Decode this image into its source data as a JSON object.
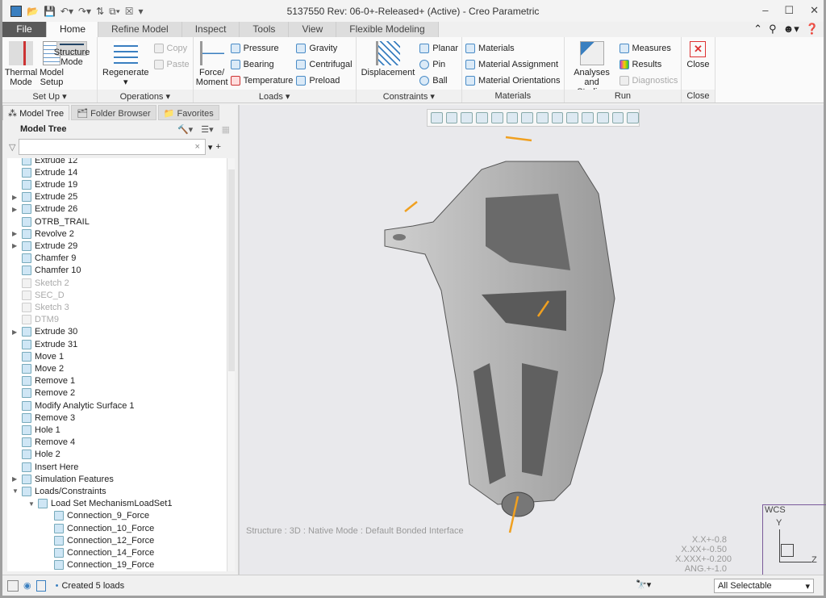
{
  "window": {
    "title": "5137550 Rev: 06-0+-Released+ (Active) - Creo Parametric"
  },
  "tabs": [
    "File",
    "Home",
    "Refine Model",
    "Inspect",
    "Tools",
    "View",
    "Flexible Modeling"
  ],
  "ribbon": {
    "setup": {
      "label": "Set Up",
      "structure": "Structure Mode",
      "thermal": "Thermal Mode",
      "model_setup": "Model Setup"
    },
    "operations": {
      "label": "Operations",
      "regenerate": "Regenerate",
      "copy": "Copy",
      "paste": "Paste"
    },
    "loads": {
      "label": "Loads",
      "force": "Force/ Moment",
      "pressure": "Pressure",
      "bearing": "Bearing",
      "temperature": "Temperature",
      "gravity": "Gravity",
      "centrifugal": "Centrifugal",
      "preload": "Preload"
    },
    "constraints": {
      "label": "Constraints",
      "displacement": "Displacement",
      "planar": "Planar",
      "pin": "Pin",
      "ball": "Ball"
    },
    "materials": {
      "label": "Materials",
      "materials": "Materials",
      "assignment": "Material Assignment",
      "orientations": "Material Orientations"
    },
    "run": {
      "label": "Run",
      "analyses": "Analyses and Studies",
      "measures": "Measures",
      "results": "Results",
      "diagnostics": "Diagnostics"
    },
    "close": {
      "label": "Close",
      "close": "Close"
    }
  },
  "panel": {
    "tabs": [
      "Model Tree",
      "Folder Browser",
      "Favorites"
    ],
    "header": "Model Tree",
    "filter_value": ""
  },
  "tree": [
    {
      "label": "Extrude 12",
      "indent": 0,
      "exp": false,
      "dim": false
    },
    {
      "label": "Extrude 14",
      "indent": 0,
      "exp": false,
      "dim": false
    },
    {
      "label": "Extrude 19",
      "indent": 0,
      "exp": false,
      "dim": false
    },
    {
      "label": "Extrude 25",
      "indent": 0,
      "exp": true,
      "dim": false
    },
    {
      "label": "Extrude 26",
      "indent": 0,
      "exp": true,
      "dim": false
    },
    {
      "label": "OTRB_TRAIL",
      "indent": 0,
      "exp": false,
      "dim": false
    },
    {
      "label": "Revolve 2",
      "indent": 0,
      "exp": true,
      "dim": false
    },
    {
      "label": "Extrude 29",
      "indent": 0,
      "exp": true,
      "dim": false
    },
    {
      "label": "Chamfer 9",
      "indent": 0,
      "exp": false,
      "dim": false
    },
    {
      "label": "Chamfer 10",
      "indent": 0,
      "exp": false,
      "dim": false
    },
    {
      "label": "Sketch 2",
      "indent": 0,
      "exp": false,
      "dim": true
    },
    {
      "label": "SEC_D",
      "indent": 0,
      "exp": false,
      "dim": true
    },
    {
      "label": "Sketch 3",
      "indent": 0,
      "exp": false,
      "dim": true
    },
    {
      "label": "DTM9",
      "indent": 0,
      "exp": false,
      "dim": true
    },
    {
      "label": "Extrude 30",
      "indent": 0,
      "exp": true,
      "dim": false
    },
    {
      "label": "Extrude 31",
      "indent": 0,
      "exp": false,
      "dim": false
    },
    {
      "label": "Move 1",
      "indent": 0,
      "exp": false,
      "dim": false
    },
    {
      "label": "Move 2",
      "indent": 0,
      "exp": false,
      "dim": false
    },
    {
      "label": "Remove 1",
      "indent": 0,
      "exp": false,
      "dim": false
    },
    {
      "label": "Remove 2",
      "indent": 0,
      "exp": false,
      "dim": false
    },
    {
      "label": "Modify Analytic Surface 1",
      "indent": 0,
      "exp": false,
      "dim": false
    },
    {
      "label": "Remove 3",
      "indent": 0,
      "exp": false,
      "dim": false
    },
    {
      "label": "Hole 1",
      "indent": 0,
      "exp": false,
      "dim": false
    },
    {
      "label": "Remove 4",
      "indent": 0,
      "exp": false,
      "dim": false
    },
    {
      "label": "Hole 2",
      "indent": 0,
      "exp": false,
      "dim": false
    },
    {
      "label": "Insert Here",
      "indent": 0,
      "exp": false,
      "dim": false
    },
    {
      "label": "Simulation Features",
      "indent": 0,
      "exp": true,
      "dim": false
    },
    {
      "label": "Loads/Constraints",
      "indent": 0,
      "exp": "open",
      "dim": false
    },
    {
      "label": "Load Set MechanismLoadSet1",
      "indent": 1,
      "exp": "open",
      "dim": false
    },
    {
      "label": "Connection_9_Force",
      "indent": 2,
      "exp": false,
      "dim": false
    },
    {
      "label": "Connection_10_Force",
      "indent": 2,
      "exp": false,
      "dim": false
    },
    {
      "label": "Connection_12_Force",
      "indent": 2,
      "exp": false,
      "dim": false
    },
    {
      "label": "Connection_14_Force",
      "indent": 2,
      "exp": false,
      "dim": false
    },
    {
      "label": "Connection_19_Force",
      "indent": 2,
      "exp": false,
      "dim": false
    }
  ],
  "viewport": {
    "mode_text": "Structure : 3D : Native Mode : Default Bonded Interface",
    "tolerances": [
      "X.X+-0.8",
      "X.XX+-0.50",
      "X.XXX+-0.200",
      "ANG.+-1.0"
    ],
    "wcs": "WCS",
    "axis_y": "Y",
    "axis_z": "Z",
    "load_color": "#f0a020"
  },
  "status": {
    "message": "Created 5 loads",
    "selection_filter": "All Selectable"
  }
}
